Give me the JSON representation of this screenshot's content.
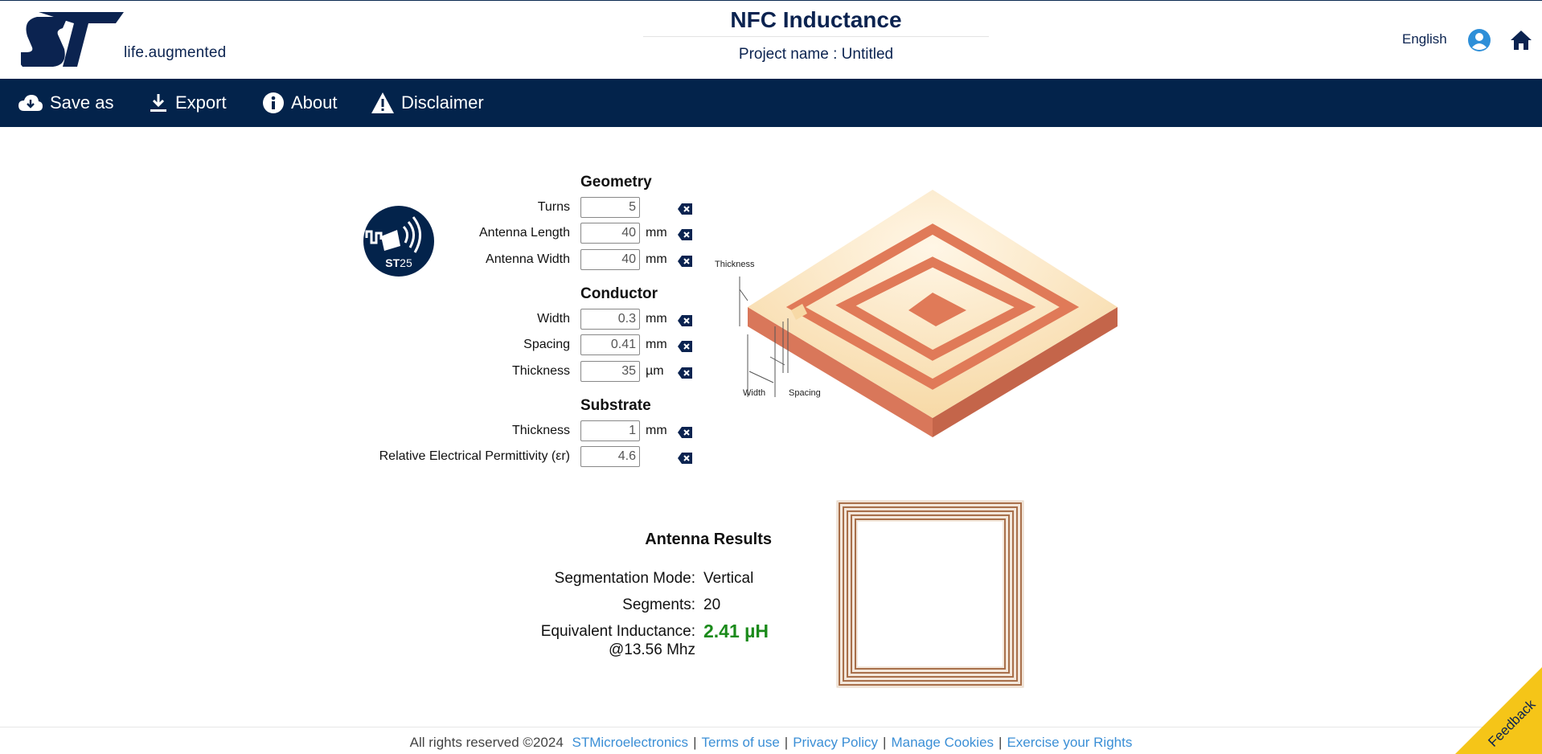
{
  "header": {
    "logo_tagline": "life.augmented",
    "title": "NFC Inductance",
    "project": "Project name : Untitled",
    "language": "English"
  },
  "toolbar": {
    "save_as": "Save as",
    "export": "Export",
    "about": "About",
    "disclaimer": "Disclaimer"
  },
  "badge": {
    "text_bold": "ST",
    "text_light": "25"
  },
  "geometry": {
    "title": "Geometry",
    "turns": {
      "label": "Turns",
      "value": "5",
      "unit": ""
    },
    "length": {
      "label": "Antenna Length",
      "value": "40",
      "unit": "mm"
    },
    "width": {
      "label": "Antenna Width",
      "value": "40",
      "unit": "mm"
    }
  },
  "conductor": {
    "title": "Conductor",
    "width": {
      "label": "Width",
      "value": "0.3",
      "unit": "mm"
    },
    "spacing": {
      "label": "Spacing",
      "value": "0.41",
      "unit": "mm"
    },
    "thickness": {
      "label": "Thickness",
      "value": "35",
      "unit": "µm"
    }
  },
  "substrate": {
    "title": "Substrate",
    "thickness": {
      "label": "Thickness",
      "value": "1",
      "unit": "mm"
    },
    "permittivity": {
      "label": "Relative Electrical Permittivity (εr)",
      "value": "4.6",
      "unit": ""
    }
  },
  "diagram": {
    "thickness_label": "Thickness",
    "width_label": "Width",
    "spacing_label": "Spacing"
  },
  "results": {
    "title": "Antenna Results",
    "mode_label": "Segmentation Mode:",
    "mode_value": "Vertical",
    "segments_label": "Segments:",
    "segments_value": "20",
    "inductance_label": "Equivalent Inductance:",
    "inductance_freq": "@13.56 Mhz",
    "inductance_value": "2.41 µH"
  },
  "footer": {
    "copyright": "All rights reserved ©2024",
    "company": "STMicroelectronics",
    "terms": "Terms of use",
    "privacy": "Privacy Policy",
    "cookies": "Manage Cookies",
    "rights": "Exercise your Rights"
  },
  "feedback": "Feedback",
  "colors": {
    "brand_navy": "#03234b",
    "result_green": "#1a8a1a",
    "link_blue": "#3b8fd6",
    "feedback_yellow": "#f5c518"
  }
}
